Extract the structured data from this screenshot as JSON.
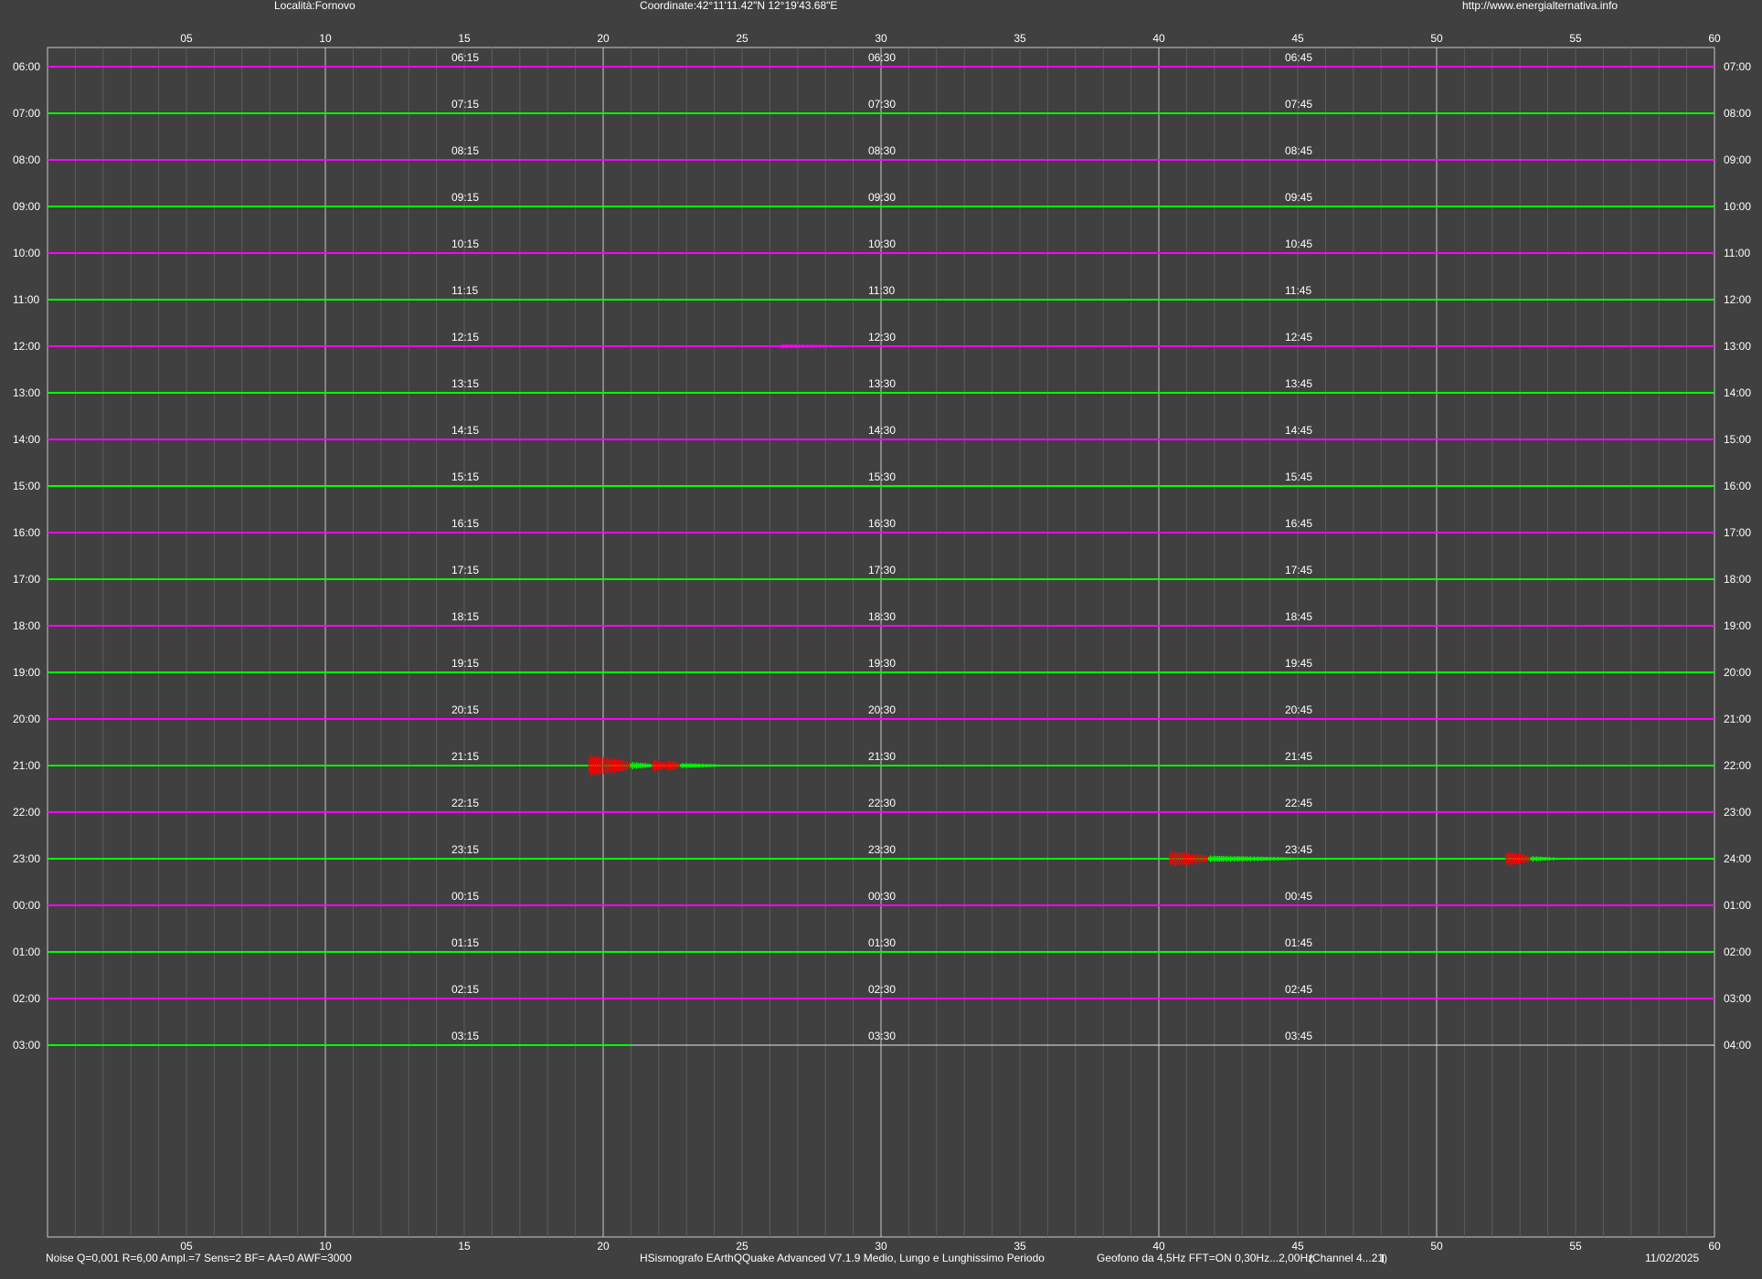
{
  "header": {
    "location": "Località:Fornovo",
    "coordinates": "Coordinate:42°11'11.42\"N  12°19'43.68\"E",
    "url": "http://www.energialternativa.info"
  },
  "footer": {
    "settings": "Noise Q=0,001 R=6,00 Ampl.=7 Sens=2 BF= AA=0 AWF=3000",
    "software": "HSismografo  EArthQQuake Advanced V7.1.9  Medio, Lungo e Lunghissimo Periodo",
    "sensor": "Geofono da 4,5Hz FFT=ON 0,30Hz...2,00Hz",
    "channel": "(Channel 4...21)",
    "date": "11/02/2025"
  },
  "colors": {
    "background": "#404040",
    "trace_magenta": "#ff00ff",
    "trace_green": "#00ff00",
    "event_red": "#ff0000",
    "grid_major": "#c8c8c8",
    "grid_minor": "#5c5c5c"
  },
  "chart_data": {
    "type": "line",
    "title": "",
    "xlabel": "",
    "ylabel": "",
    "xlim": [
      0,
      60
    ],
    "x_tick_labels": [
      "05",
      "10",
      "15",
      "20",
      "25",
      "30",
      "35",
      "40",
      "45",
      "50",
      "55",
      "60"
    ],
    "grid": "on",
    "rows": [
      {
        "left": "06:00",
        "right": "07:00",
        "marks": [
          "06:15",
          "06:30",
          "06:45"
        ],
        "color": "magenta",
        "end_minute": 60
      },
      {
        "left": "07:00",
        "right": "08:00",
        "marks": [
          "07:15",
          "07:30",
          "07:45"
        ],
        "color": "green",
        "end_minute": 60
      },
      {
        "left": "08:00",
        "right": "09:00",
        "marks": [
          "08:15",
          "08:30",
          "08:45"
        ],
        "color": "magenta",
        "end_minute": 60
      },
      {
        "left": "09:00",
        "right": "10:00",
        "marks": [
          "09:15",
          "09:30",
          "09:45"
        ],
        "color": "green",
        "end_minute": 60
      },
      {
        "left": "10:00",
        "right": "11:00",
        "marks": [
          "10:15",
          "10:30",
          "10:45"
        ],
        "color": "magenta",
        "end_minute": 60
      },
      {
        "left": "11:00",
        "right": "12:00",
        "marks": [
          "11:15",
          "11:30",
          "11:45"
        ],
        "color": "green",
        "end_minute": 60
      },
      {
        "left": "12:00",
        "right": "13:00",
        "marks": [
          "12:15",
          "12:30",
          "12:45"
        ],
        "color": "magenta",
        "end_minute": 60
      },
      {
        "left": "13:00",
        "right": "14:00",
        "marks": [
          "13:15",
          "13:30",
          "13:45"
        ],
        "color": "green",
        "end_minute": 60
      },
      {
        "left": "14:00",
        "right": "15:00",
        "marks": [
          "14:15",
          "14:30",
          "14:45"
        ],
        "color": "magenta",
        "end_minute": 60
      },
      {
        "left": "15:00",
        "right": "16:00",
        "marks": [
          "15:15",
          "15:30",
          "15:45"
        ],
        "color": "green",
        "end_minute": 60
      },
      {
        "left": "16:00",
        "right": "17:00",
        "marks": [
          "16:15",
          "16:30",
          "16:45"
        ],
        "color": "magenta",
        "end_minute": 60
      },
      {
        "left": "17:00",
        "right": "18:00",
        "marks": [
          "17:15",
          "17:30",
          "17:45"
        ],
        "color": "green",
        "end_minute": 60
      },
      {
        "left": "18:00",
        "right": "19:00",
        "marks": [
          "18:15",
          "18:30",
          "18:45"
        ],
        "color": "magenta",
        "end_minute": 60
      },
      {
        "left": "19:00",
        "right": "20:00",
        "marks": [
          "19:15",
          "19:30",
          "19:45"
        ],
        "color": "green",
        "end_minute": 60
      },
      {
        "left": "20:00",
        "right": "21:00",
        "marks": [
          "20:15",
          "20:30",
          "20:45"
        ],
        "color": "magenta",
        "end_minute": 60
      },
      {
        "left": "21:00",
        "right": "22:00",
        "marks": [
          "21:15",
          "21:30",
          "21:45"
        ],
        "color": "green",
        "end_minute": 60
      },
      {
        "left": "22:00",
        "right": "23:00",
        "marks": [
          "22:15",
          "22:30",
          "22:45"
        ],
        "color": "magenta",
        "end_minute": 60
      },
      {
        "left": "23:00",
        "right": "24:00",
        "marks": [
          "23:15",
          "23:30",
          "23:45"
        ],
        "color": "green",
        "end_minute": 60
      },
      {
        "left": "00:00",
        "right": "01:00",
        "marks": [
          "00:15",
          "00:30",
          "00:45"
        ],
        "color": "magenta",
        "end_minute": 60
      },
      {
        "left": "01:00",
        "right": "02:00",
        "marks": [
          "01:15",
          "01:30",
          "01:45"
        ],
        "color": "green",
        "end_minute": 60
      },
      {
        "left": "02:00",
        "right": "03:00",
        "marks": [
          "02:15",
          "02:30",
          "02:45"
        ],
        "color": "magenta",
        "end_minute": 60
      },
      {
        "left": "03:00",
        "right": "04:00",
        "marks": [
          "03:15",
          "03:30",
          "03:45"
        ],
        "color": "green",
        "end_minute": 21
      }
    ],
    "events": [
      {
        "row": 15,
        "start_minute": 19.5,
        "end_minute": 21.0,
        "amplitude": 1.0,
        "color": "red"
      },
      {
        "row": 15,
        "start_minute": 21.0,
        "end_minute": 21.8,
        "amplitude": 0.35,
        "color": "green"
      },
      {
        "row": 15,
        "start_minute": 21.8,
        "end_minute": 22.3,
        "amplitude": 0.55,
        "color": "red"
      },
      {
        "row": 15,
        "start_minute": 22.3,
        "end_minute": 22.8,
        "amplitude": 0.5,
        "color": "red"
      },
      {
        "row": 15,
        "start_minute": 22.8,
        "end_minute": 24.3,
        "amplitude": 0.25,
        "color": "green"
      },
      {
        "row": 17,
        "start_minute": 40.4,
        "end_minute": 41.8,
        "amplitude": 0.75,
        "color": "red"
      },
      {
        "row": 17,
        "start_minute": 41.8,
        "end_minute": 45.0,
        "amplitude": 0.3,
        "color": "green"
      },
      {
        "row": 17,
        "start_minute": 52.5,
        "end_minute": 53.4,
        "amplitude": 0.7,
        "color": "red"
      },
      {
        "row": 17,
        "start_minute": 53.4,
        "end_minute": 54.4,
        "amplitude": 0.25,
        "color": "green"
      },
      {
        "row": 6,
        "start_minute": 26.4,
        "end_minute": 28.8,
        "amplitude": 0.2,
        "color": "magenta"
      }
    ]
  }
}
